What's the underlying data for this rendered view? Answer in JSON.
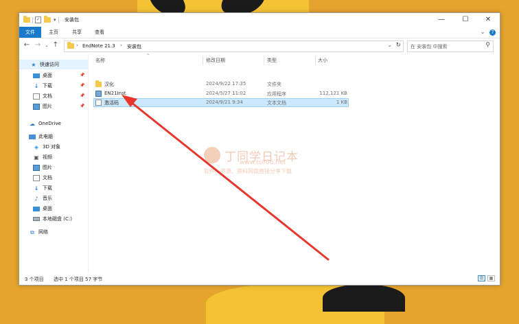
{
  "window": {
    "title": "安装包",
    "quick_access_toolbar": {
      "sep_glyph": "|",
      "dropdown_glyph": "▾"
    },
    "controls": {
      "minimize": "—",
      "maximize": "☐",
      "close": "✕"
    }
  },
  "ribbon": {
    "tabs": [
      {
        "label": "文件",
        "active": true
      },
      {
        "label": "主页"
      },
      {
        "label": "共享"
      },
      {
        "label": "查看"
      }
    ],
    "expand_glyph": "⌄",
    "help_glyph": "?"
  },
  "address": {
    "back": "←",
    "forward": "→",
    "recent": "⌄",
    "up": "↑",
    "crumbs": [
      "EndNote 21.3",
      "安装包"
    ],
    "crumb_sep": "›",
    "dropdown": "⌄",
    "refresh": "↻"
  },
  "search": {
    "placeholder": "在 安装包 中搜索",
    "icon_glyph": "⚲"
  },
  "nav_pane": {
    "quick_access": {
      "label": "快速访问",
      "items": [
        {
          "label": "桌面",
          "icon": "desktop-icon",
          "pinned": true
        },
        {
          "label": "下载",
          "icon": "download-icon",
          "pinned": true
        },
        {
          "label": "文档",
          "icon": "documents-icon",
          "pinned": true
        },
        {
          "label": "图片",
          "icon": "pictures-icon",
          "pinned": true
        }
      ]
    },
    "onedrive": {
      "label": "OneDrive"
    },
    "this_pc": {
      "label": "此电脑",
      "items": [
        {
          "label": "3D 对象",
          "icon": "3d-objects-icon"
        },
        {
          "label": "视频",
          "icon": "videos-icon"
        },
        {
          "label": "图片",
          "icon": "pictures-icon"
        },
        {
          "label": "文档",
          "icon": "documents-icon"
        },
        {
          "label": "下载",
          "icon": "download-icon"
        },
        {
          "label": "音乐",
          "icon": "music-icon"
        },
        {
          "label": "桌面",
          "icon": "desktop-icon"
        },
        {
          "label": "本地磁盘 (C:)",
          "icon": "drive-icon"
        }
      ]
    },
    "network": {
      "label": "网络"
    },
    "pin_glyph": "📌"
  },
  "file_list": {
    "sort_glyph": "^",
    "columns": [
      "名称",
      "修改日期",
      "类型",
      "大小"
    ],
    "rows": [
      {
        "name": "汉化",
        "modified": "2024/9/22 17:35",
        "type": "文件夹",
        "size": "",
        "icon": "folder-icon",
        "selected": false
      },
      {
        "name": "EN21Inst",
        "modified": "2024/5/27 11:02",
        "type": "应用程序",
        "size": "112,121 KB",
        "icon": "installer-icon",
        "selected": false
      },
      {
        "name": "激活码",
        "modified": "2024/9/21 9:34",
        "type": "文本文档",
        "size": "1 KB",
        "icon": "text-file-icon",
        "selected": true
      }
    ]
  },
  "watermark": {
    "title": "丁同学日记本",
    "url": "www.ts006.net",
    "subtitle": "软件、资源、资料网盘直接分享下载"
  },
  "status": {
    "item_count": "3 个项目",
    "selection": "选中 1 个项目 57 字节",
    "details_view_glyph": "☰",
    "icons_view_glyph": "▦"
  },
  "colors": {
    "accent": "#1979CA",
    "selection": "#CCE8FF",
    "arrow": "#E8362D",
    "background": "#E5A42E"
  }
}
